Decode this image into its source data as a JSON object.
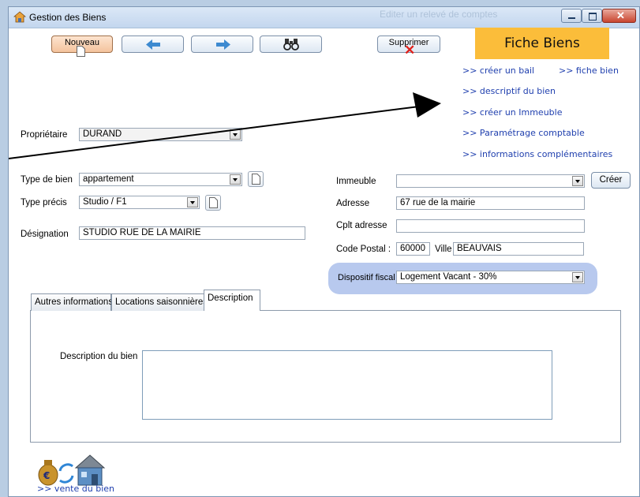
{
  "window": {
    "title": "Gestion des Biens",
    "bg_watermark": "Editer un relevé de comptes"
  },
  "toolbar": {
    "nouveau_label": "Nouveau",
    "supprimer_label": "Supprimer",
    "prev_icon": "arrow-left-icon",
    "next_icon": "arrow-right-icon",
    "search_icon": "binoculars-icon"
  },
  "header": {
    "title": "Fiche Biens"
  },
  "links": {
    "creer_bail": ">> créer un bail",
    "fiche_bien": ">> fiche bien",
    "descriptif": ">> descriptif du bien",
    "creer_immeuble": ">> créer un Immeuble",
    "parametrage": ">> Paramétrage comptable",
    "infos": ">> informations complémentaires",
    "vente": ">> vente du bien"
  },
  "form": {
    "proprietaire_label": "Propriétaire",
    "proprietaire_value": "DURAND",
    "type_bien_label": "Type de bien",
    "type_bien_value": "appartement",
    "type_precis_label": "Type précis",
    "type_precis_value": "Studio / F1",
    "designation_label": "Désignation",
    "designation_value": "STUDIO RUE DE LA MAIRIE",
    "immeuble_label": "Immeuble",
    "immeuble_value": "",
    "creer_label": "Créer",
    "adresse_label": "Adresse",
    "adresse_value": "67 rue de la mairie",
    "cplt_label": "Cplt adresse",
    "cplt_value": "",
    "cp_label": "Code Postal :",
    "cp_value": "60000",
    "ville_label": "Ville",
    "ville_value": "BEAUVAIS",
    "dispositif_label": "Dispositif fiscal",
    "dispositif_value": "Logement Vacant - 30%"
  },
  "tabs": [
    {
      "label": "Autres informations"
    },
    {
      "label": "Locations saisonnières"
    },
    {
      "label": "Description"
    }
  ],
  "description": {
    "label": "Description du bien",
    "value": ""
  },
  "colors": {
    "accent_header": "#fbbd3a",
    "link": "#1f3fae",
    "dispositif_bg": "#b8c9ee"
  }
}
